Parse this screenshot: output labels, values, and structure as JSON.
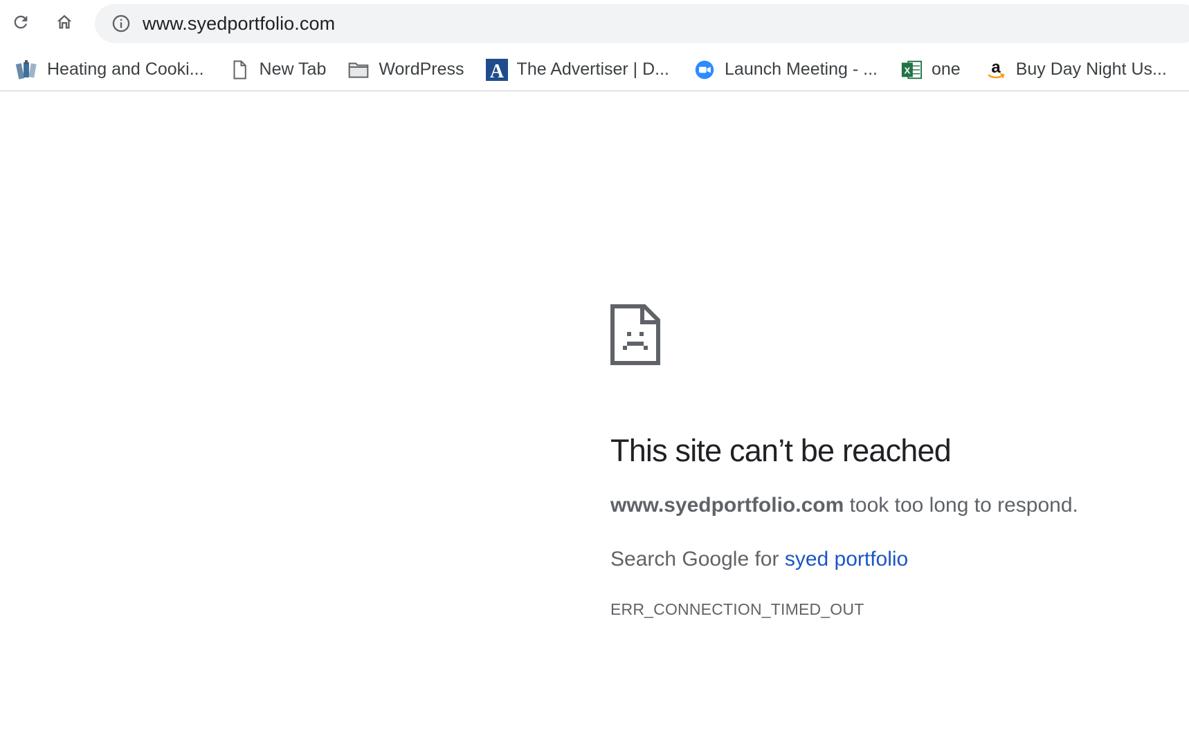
{
  "omnibox": {
    "url": "www.syedportfolio.com"
  },
  "bookmarks": [
    {
      "label": "Heating and Cooki...",
      "icon": "site-favicon-icon"
    },
    {
      "label": "New Tab",
      "icon": "page-icon"
    },
    {
      "label": "WordPress",
      "icon": "folder-icon"
    },
    {
      "label": "The Advertiser | D...",
      "icon": "advertiser-logo-icon"
    },
    {
      "label": "Launch Meeting - ...",
      "icon": "zoom-icon"
    },
    {
      "label": "one",
      "icon": "excel-icon"
    },
    {
      "label": "Buy Day Night Us...",
      "icon": "amazon-icon"
    }
  ],
  "error": {
    "title": "This site can’t be reached",
    "host": "www.syedportfolio.com",
    "desc_suffix": " took too long to respond.",
    "search_prefix": "Search Google for ",
    "search_link": "syed portfolio",
    "code": "ERR_CONNECTION_TIMED_OUT"
  },
  "colors": {
    "link": "#1a55c7",
    "omnibox_bg": "#f1f3f4",
    "text_secondary": "#5f6368"
  }
}
